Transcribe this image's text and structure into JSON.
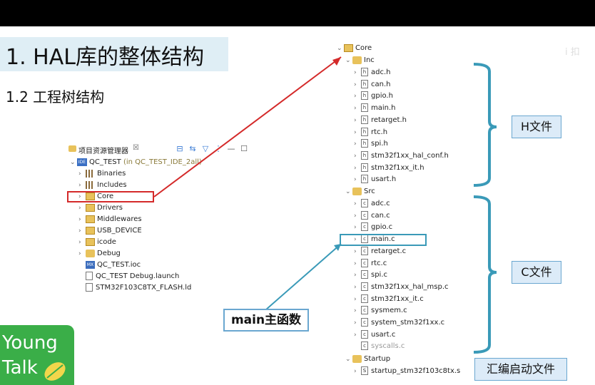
{
  "slide": {
    "title": "1. HAL库的整体结构",
    "subtitle": "1.2 工程树结构",
    "watermark": "i 扣"
  },
  "explorer": {
    "header_title": "项目资源管理器",
    "close": "☒",
    "project_name": "QC_TEST",
    "project_suffix": "(in QC_TEST_IDE_2all)",
    "items": [
      {
        "label": "Binaries",
        "icon": "binaries-icon"
      },
      {
        "label": "Includes",
        "icon": "includes-icon"
      },
      {
        "label": "Core",
        "icon": "folder-icon"
      },
      {
        "label": "Drivers",
        "icon": "folder-icon"
      },
      {
        "label": "Middlewares",
        "icon": "folder-icon"
      },
      {
        "label": "USB_DEVICE",
        "icon": "folder-icon"
      },
      {
        "label": "icode",
        "icon": "folder-icon"
      },
      {
        "label": "Debug",
        "icon": "folder-icon"
      },
      {
        "label": "QC_TEST.ioc",
        "icon": "mx-icon"
      },
      {
        "label": "QC_TEST Debug.launch",
        "icon": "file-icon"
      },
      {
        "label": "STM32F103C8TX_FLASH.ld",
        "icon": "ld-icon"
      }
    ]
  },
  "tree": {
    "core": "Core",
    "inc": "Inc",
    "inc_files": [
      "adc.h",
      "can.h",
      "gpio.h",
      "main.h",
      "retarget.h",
      "rtc.h",
      "spi.h",
      "stm32f1xx_hal_conf.h",
      "stm32f1xx_it.h",
      "usart.h"
    ],
    "src": "Src",
    "src_files": [
      "adc.c",
      "can.c",
      "gpio.c",
      "main.c",
      "retarget.c",
      "rtc.c",
      "spi.c",
      "stm32f1xx_hal_msp.c",
      "stm32f1xx_it.c",
      "sysmem.c",
      "system_stm32f1xx.c",
      "usart.c",
      "syscalls.c"
    ],
    "startup": "Startup",
    "startup_files": [
      "startup_stm32f103c8tx.s"
    ]
  },
  "labels": {
    "h_files": "H文件",
    "c_files": "C文件",
    "asm_files": "汇编启动文件",
    "main_func": "main主函数"
  },
  "logo": {
    "line1": "Young",
    "line2": "Talk"
  },
  "colors": {
    "red": "#d42a2a",
    "blue": "#3a9ab8",
    "topbar": "#000000",
    "logo": "#3aae48"
  }
}
